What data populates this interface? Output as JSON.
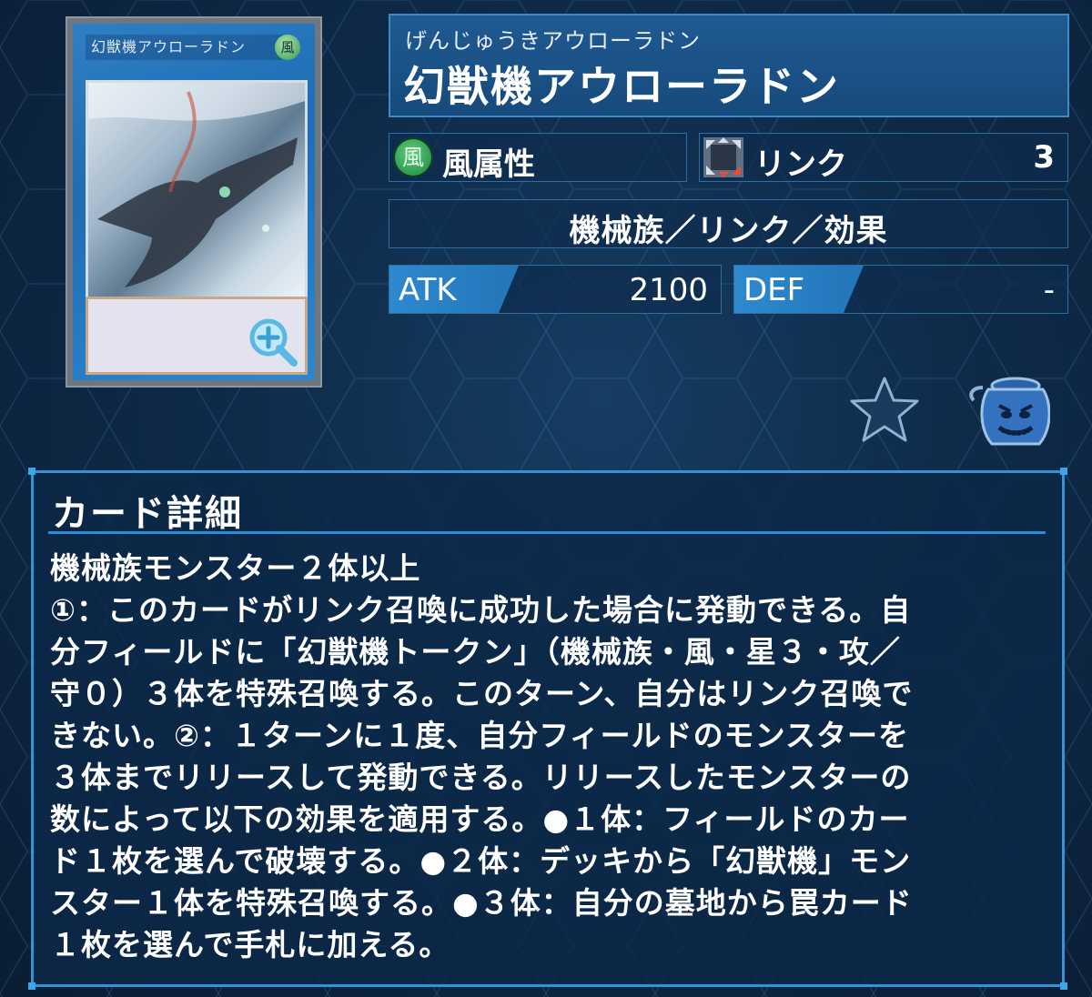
{
  "card": {
    "thumb_name": "幻獣機アウローラドン",
    "thumb_attr_glyph": "風",
    "ruby": "げんじゅうきアウローラドン",
    "name": "幻獣機アウローラドン"
  },
  "attribute": {
    "glyph": "風",
    "label": "風属性"
  },
  "link": {
    "label": "リンク",
    "value": "3"
  },
  "type_line": "機械族／リンク／効果",
  "stats": {
    "atk_label": "ATK",
    "atk_value": "2100",
    "def_label": "DEF",
    "def_value": "-"
  },
  "actions": {
    "favorite_icon": "star-icon",
    "deck_icon": "pot-of-greed-icon"
  },
  "detail": {
    "title": "カード詳細",
    "lines": [
      "機械族モンスター２体以上",
      "①：このカードがリンク召喚に成功した場合に発動できる。自",
      "分フィールドに「幻獣機トークン」（機械族・風・星３・攻／",
      "守０）３体を特殊召喚する。このターン、自分はリンク召喚で",
      "きない。②：１ターンに１度、自分フィールドのモンスターを",
      "３体までリリースして発動できる。リリースしたモンスターの",
      "数によって以下の効果を適用する。●１体：フィールドのカー",
      "ド１枚を選んで破壊する。●２体：デッキから「幻獣機」モン",
      "スター１体を特殊召喚する。●３体：自分の墓地から罠カード",
      "１枚を選んで手札に加える。"
    ]
  },
  "colors": {
    "accent": "#3592d3",
    "background": "#0e2a48",
    "wind_attr": "#2f9a50"
  }
}
